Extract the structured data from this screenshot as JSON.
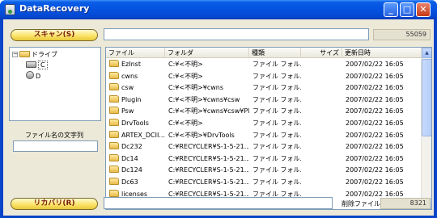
{
  "window": {
    "title": "DataRecovery"
  },
  "buttons": {
    "scan": "スキャン(S)",
    "recover": "リカバリ(R)"
  },
  "top": {
    "path_value": "",
    "count": "55059"
  },
  "tree": {
    "root_label": "ドライブ",
    "drives": [
      "C",
      "D"
    ]
  },
  "filter": {
    "label": "ファイル名の文字列",
    "value": ""
  },
  "bottom": {
    "status_value": "",
    "deleted_label": "削除ファイル",
    "deleted_count": "8321"
  },
  "file_list": {
    "columns": [
      "ファイル",
      "フォルダ",
      "種類",
      "サイズ",
      "更新日時"
    ],
    "rows": [
      [
        "EzInst",
        "C:¥<不明>",
        "ファイル フォル...",
        "",
        "2007/02/22 16:05"
      ],
      [
        "cwns",
        "C:¥<不明>",
        "ファイル フォル...",
        "",
        "2007/02/22 16:05"
      ],
      [
        "csw",
        "C:¥<不明>¥cwns",
        "ファイル フォル...",
        "",
        "2007/02/22 16:05"
      ],
      [
        "Plugin",
        "C:¥<不明>¥cwns¥csw",
        "ファイル フォル...",
        "",
        "2007/02/22 16:05"
      ],
      [
        "Psw",
        "C:¥<不明>¥cwns¥csw¥Pl...",
        "ファイル フォル...",
        "",
        "2007/02/22 16:05"
      ],
      [
        "DrvTools",
        "C:¥<不明>",
        "ファイル フォル...",
        "",
        "2007/02/22 16:05"
      ],
      [
        "ARTEX_DCII...",
        "C:¥<不明>¥DrvTools",
        "ファイル フォル...",
        "",
        "2007/02/22 16:05"
      ],
      [
        "Dc232",
        "C:¥RECYCLER¥S-1-5-21...",
        "ファイル フォル...",
        "",
        "2007/02/22 16:05"
      ],
      [
        "Dc14",
        "C:¥RECYCLER¥S-1-5-21...",
        "ファイル フォル...",
        "",
        "2007/02/22 16:05"
      ],
      [
        "Dc124",
        "C:¥RECYCLER¥S-1-5-21...",
        "ファイル フォル...",
        "",
        "2007/02/22 16:05"
      ],
      [
        "Dc63",
        "C:¥RECYCLER¥S-1-5-21...",
        "ファイル フォル...",
        "",
        "2007/02/22 16:05"
      ],
      [
        "licenses",
        "C:¥RECYCLER¥S-1-5-21...",
        "ファイル フォル...",
        "",
        "2007/02/22 16:05"
      ]
    ]
  }
}
